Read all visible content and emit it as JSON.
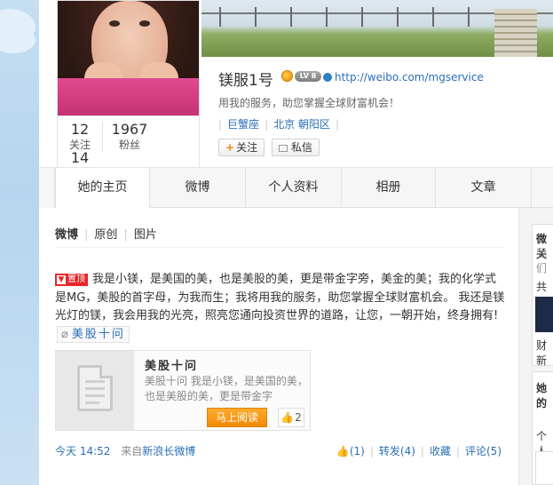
{
  "profile": {
    "name": "镁服1号",
    "level_badge": "LV 8",
    "url": "http://weibo.com/mgservice",
    "intro": "用我的服务，助您掌握全球财富机会！",
    "constellation": "巨蟹座",
    "location": "北京 朝阳区",
    "follow_btn": "关注",
    "message_btn": "私信",
    "stats": [
      {
        "value": "12",
        "label": "关注"
      },
      {
        "value": "1967",
        "label": "粉丝"
      },
      {
        "value": "14",
        "label": ""
      }
    ]
  },
  "tabs": [
    "她的主页",
    "微博",
    "个人资料",
    "相册",
    "文章"
  ],
  "feed": {
    "subtabs": [
      "微博",
      "原创",
      "图片"
    ],
    "post": {
      "badge": "置顶",
      "text": "我是小镁，是美国的美，也是美股的美，更是带金字旁，美金的美；我的化学式是MG，美股的首字母，为我而生；我将用我的服务，助您掌握全球财富机会。 我还是镁光灯的镁，我会用我的光亮，照亮您通向投资世界的道路，让您，一朝开始，终身拥有!",
      "inline_link": "美股十问",
      "card": {
        "title": "美股十问",
        "desc": "美股十问 我是小镁，是美国的美，也是美股的美，更是带金字",
        "read_btn": "马上阅读",
        "likes": "2"
      },
      "time": "今天 14:52",
      "from_label": "来自",
      "source": "新浪长微博",
      "like_count": "(1)",
      "repost": "转发(4)",
      "favorite": "收藏",
      "comment": "评论(5)"
    }
  },
  "right_column": {
    "items": [
      "微关",
      "我们",
      "共同",
      "财新",
      "她的",
      "个人"
    ]
  },
  "colors": {
    "link": "#2a6fb6",
    "orange": "#f28a05",
    "pin_red": "#e8262a"
  }
}
